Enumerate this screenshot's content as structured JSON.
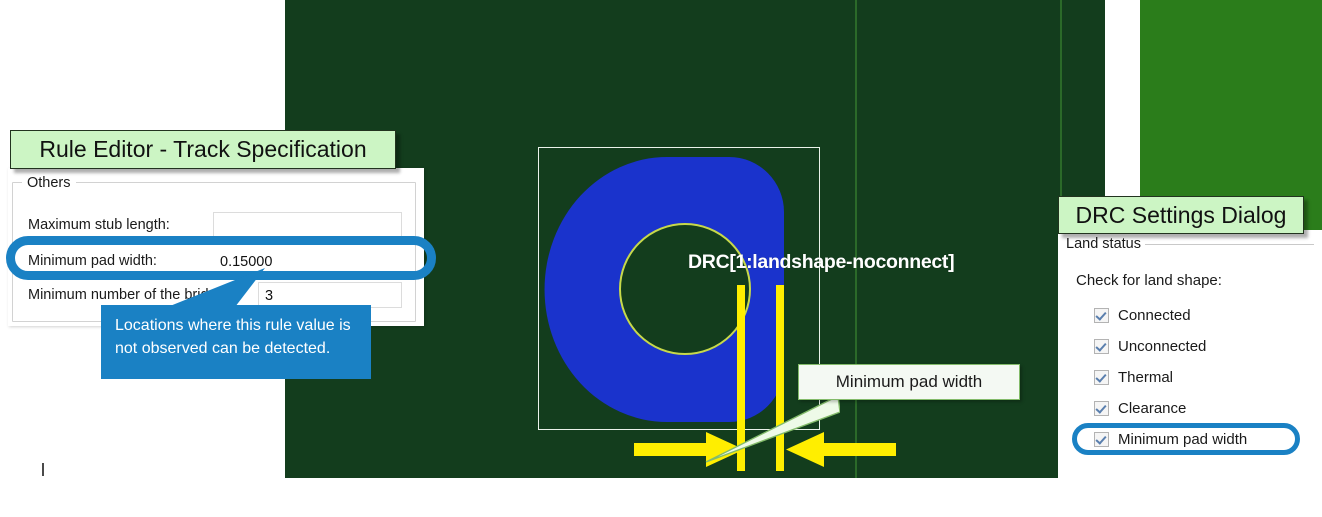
{
  "annotations": {
    "rule_editor_title": "Rule Editor - Track Specification",
    "drc_title": "DRC Settings Dialog",
    "tooltip_text": "Locations where this rule value is not observed can be detected.",
    "callout_label": "Minimum pad width"
  },
  "rule_editor": {
    "group_title": "Others",
    "fields": [
      {
        "label": "Maximum stub length:",
        "value": ""
      },
      {
        "label": "Minimum pad width:",
        "value": "0.15000"
      },
      {
        "label": "Minimum number of the bridge:",
        "value": "3"
      }
    ]
  },
  "drc_dialog": {
    "group_title": "Land status",
    "subtitle": "Check for land shape:",
    "checkboxes": [
      {
        "label": "Connected",
        "checked": true
      },
      {
        "label": "Unconnected",
        "checked": true
      },
      {
        "label": "Thermal",
        "checked": true
      },
      {
        "label": "Clearance",
        "checked": true
      },
      {
        "label": "Minimum pad width",
        "checked": true
      }
    ]
  },
  "canvas": {
    "drc_violation_label": "DRC[1:landshape-noconnect]",
    "colors": {
      "board_dark_green": "#133d1d",
      "board_bright_green": "#2b7d1b",
      "pad_blue": "#1a33cc",
      "marker_yellow": "#ffee00",
      "outline_white": "#eaf2ea",
      "hole_outline": "#c7d94a"
    }
  }
}
